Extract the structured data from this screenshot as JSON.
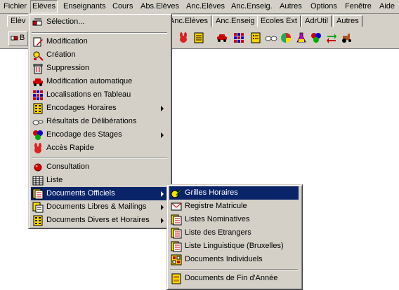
{
  "menubar": {
    "items": [
      {
        "label": "Fichier"
      },
      {
        "label": "Elèves"
      },
      {
        "label": "Enseignants"
      },
      {
        "label": "Cours"
      },
      {
        "label": "Abs.Elèves"
      },
      {
        "label": "Anc.Elèves"
      },
      {
        "label": "Anc.Enseig."
      },
      {
        "label": "Autres"
      },
      {
        "label": "Options"
      },
      {
        "label": "Fenêtre"
      },
      {
        "label": "Aide"
      }
    ]
  },
  "tabs": {
    "items": [
      {
        "label": "Elèv"
      },
      {
        "label": "Anc.Elèves"
      },
      {
        "label": "Anc.Enseig"
      },
      {
        "label": "Ecoles Ext"
      },
      {
        "label": "AdrUtil"
      },
      {
        "label": "Autres"
      }
    ]
  },
  "toolbar": {
    "first_button_fragment": "B",
    "icons": [
      "bunny-icon",
      "document-icon",
      "car-icon",
      "grid-icon",
      "notepad-icon",
      "glasses-icon",
      "chart-pie-icon",
      "flask-icon",
      "puzzle-icon",
      "arrows-icon",
      "tractor-icon"
    ]
  },
  "eleves_menu": {
    "items": [
      {
        "label": "Sélection...",
        "icon": "selection-icon",
        "submenu": false
      },
      {
        "label": "Modification",
        "icon": "edit-icon",
        "submenu": false
      },
      {
        "label": "Création",
        "icon": "create-icon",
        "submenu": false
      },
      {
        "label": "Suppression",
        "icon": "trash-icon",
        "submenu": false
      },
      {
        "label": "Modification automatique",
        "icon": "car-icon",
        "submenu": false
      },
      {
        "label": "Localisations en Tableau",
        "icon": "grid-icon",
        "submenu": false
      },
      {
        "label": "Encodages Horaires",
        "icon": "schedule-icon",
        "submenu": true
      },
      {
        "label": "Résultats de Délibérations",
        "icon": "glasses-icon",
        "submenu": false
      },
      {
        "label": "Encodage des Stages",
        "icon": "puzzle-icon",
        "submenu": true
      },
      {
        "label": "Accès Rapide",
        "icon": "bunny-icon",
        "submenu": false
      },
      {
        "label": "Consultation",
        "icon": "red-dot-icon",
        "submenu": false
      },
      {
        "label": "Liste",
        "icon": "table-icon",
        "submenu": false
      },
      {
        "label": "Documents Officiels",
        "icon": "documents-icon",
        "submenu": true
      },
      {
        "label": "Documents Libres  & Mailings",
        "icon": "mail-docs-icon",
        "submenu": true
      },
      {
        "label": "Documents Divers et Horaires",
        "icon": "schedule-icon",
        "submenu": true
      }
    ]
  },
  "docs_submenu": {
    "items": [
      {
        "label": "Grilles Horaires",
        "icon": "pencil-icon"
      },
      {
        "label": "Registre Matricule",
        "icon": "envelope-icon"
      },
      {
        "label": "Listes Nominatives",
        "icon": "document-list-icon"
      },
      {
        "label": "Liste des Etrangers",
        "icon": "document-list-icon"
      },
      {
        "label": "Liste Linguistique (Bruxelles)",
        "icon": "document-list-icon"
      },
      {
        "label": "Documents Individuels",
        "icon": "document-grid-icon"
      },
      {
        "label": "Documents de Fin d'Année",
        "icon": "document-yellow-icon"
      }
    ]
  },
  "colors": {
    "menu_bg": "#d4d0c8",
    "highlight": "#0a246a",
    "highlight_text": "#ffffff"
  }
}
